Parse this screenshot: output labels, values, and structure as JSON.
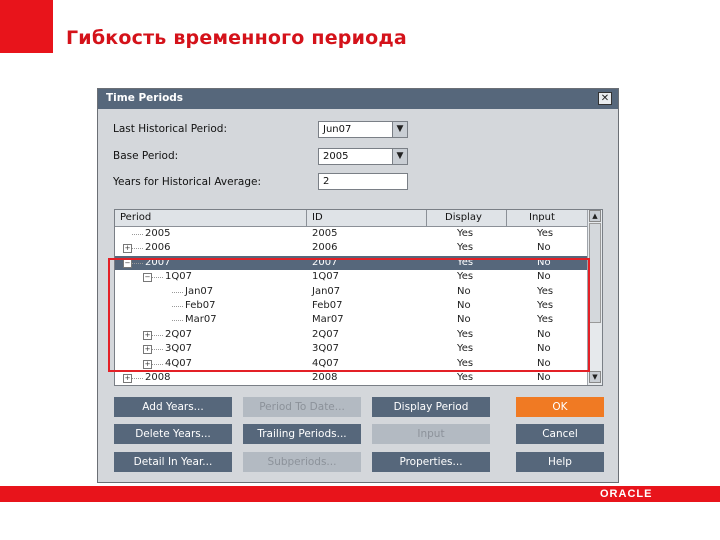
{
  "slide": {
    "title": "Гибкость временного периода",
    "logo": "ORACLE",
    "colors": {
      "brand_red": "#e8141b",
      "title_red": "#d4121a",
      "dialog_bg": "#d4d7db",
      "button_blue": "#56677b",
      "ok_orange": "#f07a23"
    }
  },
  "dialog": {
    "title": "Time Periods",
    "close_icon": "close-icon",
    "fields": {
      "last_historical_label": "Last Historical Period:",
      "last_historical_value": "Jun07",
      "base_period_label": "Base Period:",
      "base_period_value": "2005",
      "years_avg_label": "Years for Historical Average:",
      "years_avg_value": "2"
    },
    "grid": {
      "headers": [
        "Period",
        "ID",
        "Display",
        "Input"
      ],
      "rows": [
        {
          "period": "2005",
          "id": "2005",
          "display": "Yes",
          "input": "Yes",
          "level": 0,
          "toggle": ""
        },
        {
          "period": "2006",
          "id": "2006",
          "display": "Yes",
          "input": "No",
          "level": 0,
          "toggle": "+"
        },
        {
          "period": "2007",
          "id": "2007",
          "display": "Yes",
          "input": "No",
          "level": 0,
          "toggle": "-",
          "selected": true
        },
        {
          "period": "1Q07",
          "id": "1Q07",
          "display": "Yes",
          "input": "No",
          "level": 1,
          "toggle": "-"
        },
        {
          "period": "Jan07",
          "id": "Jan07",
          "display": "No",
          "input": "Yes",
          "level": 2,
          "toggle": ""
        },
        {
          "period": "Feb07",
          "id": "Feb07",
          "display": "No",
          "input": "Yes",
          "level": 2,
          "toggle": ""
        },
        {
          "period": "Mar07",
          "id": "Mar07",
          "display": "No",
          "input": "Yes",
          "level": 2,
          "toggle": ""
        },
        {
          "period": "2Q07",
          "id": "2Q07",
          "display": "Yes",
          "input": "No",
          "level": 1,
          "toggle": "+"
        },
        {
          "period": "3Q07",
          "id": "3Q07",
          "display": "Yes",
          "input": "No",
          "level": 1,
          "toggle": "+"
        },
        {
          "period": "4Q07",
          "id": "4Q07",
          "display": "Yes",
          "input": "No",
          "level": 1,
          "toggle": "+"
        },
        {
          "period": "2008",
          "id": "2008",
          "display": "Yes",
          "input": "No",
          "level": 0,
          "toggle": "+"
        }
      ]
    },
    "buttons": {
      "add_years": "Add Years...",
      "period_to_date": "Period To Date...",
      "display_period": "Display Period",
      "ok": "OK",
      "delete_years": "Delete Years...",
      "trailing_periods": "Trailing Periods...",
      "input": "Input",
      "cancel": "Cancel",
      "detail_in_year": "Detail In Year...",
      "subperiods": "Subperiods...",
      "properties": "Properties...",
      "help": "Help"
    }
  }
}
